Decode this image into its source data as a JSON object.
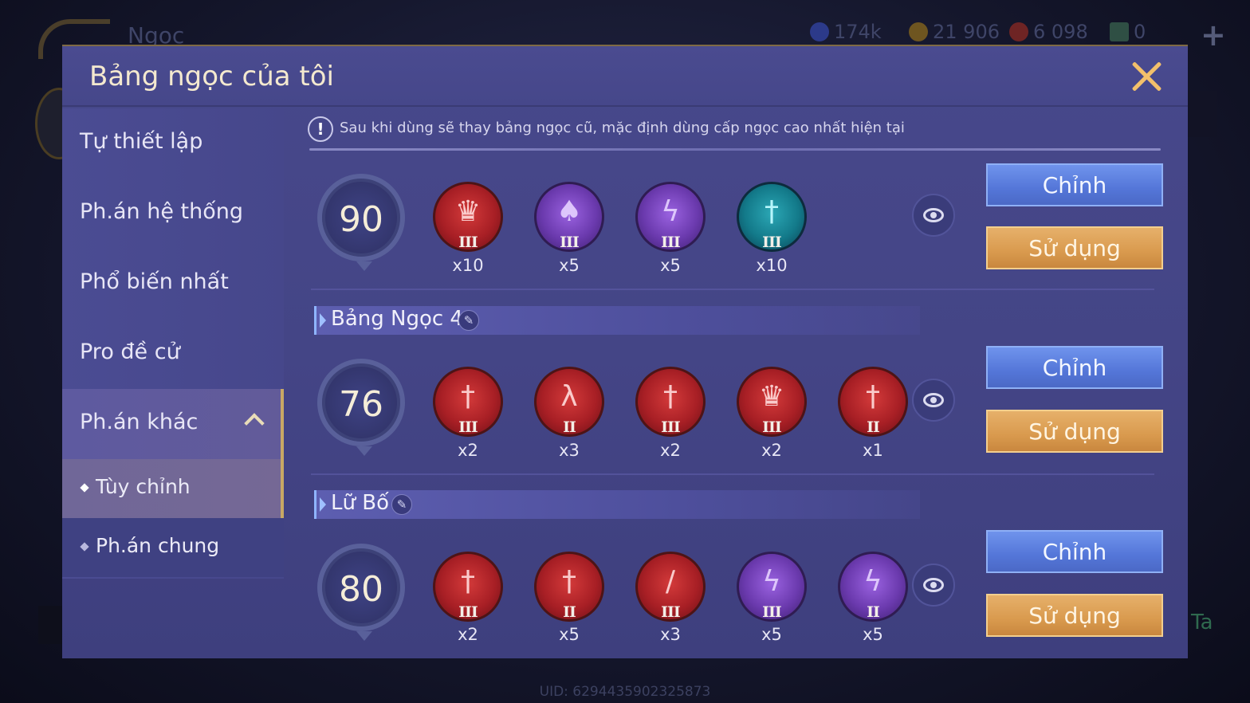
{
  "background": {
    "title": "Ngọc",
    "resources": [
      {
        "icon": "spiral-token-icon",
        "value": "174k",
        "color": "#3b4db0"
      },
      {
        "icon": "gold-coin-icon",
        "value": "21 906",
        "color": "#b8892a"
      },
      {
        "icon": "red-gem-icon",
        "value": "6 098",
        "color": "#b83a3a"
      },
      {
        "icon": "green-card-icon",
        "value": "0",
        "color": "#3a8a60"
      }
    ],
    "uid": "UID: 6294435902325873"
  },
  "modal": {
    "title": "Bảng ngọc của tôi",
    "notice": "Sau khi dùng sẽ thay bảng ngọc cũ, mặc định dùng cấp ngọc cao nhất hiện tại"
  },
  "sidebar": {
    "items": [
      {
        "label": "Tự thiết lập"
      },
      {
        "label": "Ph.án hệ thống"
      },
      {
        "label": "Phổ biến nhất"
      },
      {
        "label": "Pro đề cử"
      },
      {
        "label": "Ph.án khác"
      }
    ],
    "sub_items": [
      {
        "label": "Tùy chỉnh"
      },
      {
        "label": "Ph.án chung"
      }
    ]
  },
  "buttons": {
    "edit": "Chỉnh",
    "use": "Sử dụng"
  },
  "sets": [
    {
      "name": "",
      "level": "90",
      "gems": [
        {
          "icon": "flame-crown-gem-icon",
          "color": "red",
          "tier": "III",
          "count": "x10"
        },
        {
          "icon": "droplet-gem-icon",
          "color": "purple",
          "tier": "III",
          "count": "x5"
        },
        {
          "icon": "lightning-gem-icon",
          "color": "purple",
          "tier": "III",
          "count": "x5"
        },
        {
          "icon": "sword-gem-icon",
          "color": "teal",
          "tier": "III",
          "count": "x10"
        }
      ]
    },
    {
      "name": "Bảng Ngọc 4",
      "level": "76",
      "gems": [
        {
          "icon": "sword-gem-icon",
          "color": "red",
          "tier": "III",
          "count": "x2"
        },
        {
          "icon": "claw-gem-icon",
          "color": "red",
          "tier": "II",
          "count": "x3"
        },
        {
          "icon": "sword-gem-icon",
          "color": "red",
          "tier": "III",
          "count": "x2"
        },
        {
          "icon": "flame-crown-gem-icon",
          "color": "red",
          "tier": "III",
          "count": "x2"
        },
        {
          "icon": "sword-gem-icon",
          "color": "red",
          "tier": "II",
          "count": "x1"
        }
      ]
    },
    {
      "name": "Lữ Bố",
      "level": "80",
      "gems": [
        {
          "icon": "sword-gem-icon",
          "color": "red",
          "tier": "III",
          "count": "x2"
        },
        {
          "icon": "sword-gem-icon",
          "color": "red",
          "tier": "II",
          "count": "x5"
        },
        {
          "icon": "blade-gem-icon",
          "color": "red",
          "tier": "III",
          "count": "x3"
        },
        {
          "icon": "lightning-gem-icon",
          "color": "purple",
          "tier": "III",
          "count": "x5"
        },
        {
          "icon": "lightning-gem-icon",
          "color": "purple",
          "tier": "II",
          "count": "x5"
        }
      ]
    }
  ]
}
